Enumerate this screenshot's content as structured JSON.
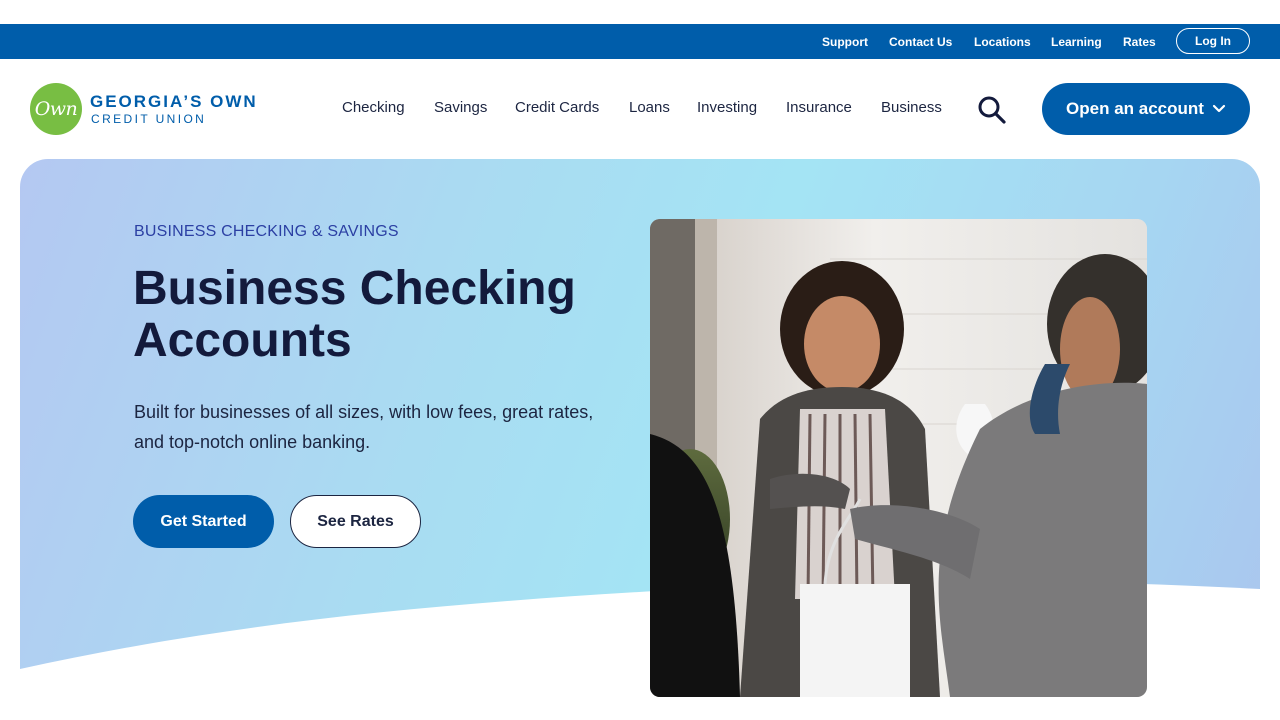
{
  "utility_nav": {
    "links": [
      "Support",
      "Contact Us",
      "Locations",
      "Learning",
      "Rates"
    ],
    "login_label": "Log In"
  },
  "header": {
    "logo": {
      "mark": "Own",
      "line1": "GEORGIA’S OWN",
      "line2": "CREDIT UNION"
    },
    "nav": [
      "Checking",
      "Savings",
      "Credit Cards",
      "Loans",
      "Investing",
      "Insurance",
      "Business"
    ],
    "search_icon": "search-icon",
    "open_account_label": "Open an account"
  },
  "hero": {
    "eyebrow": "BUSINESS CHECKING & SAVINGS",
    "title": "Business Checking Accounts",
    "description": "Built for businesses of all sizes, with low fees, great rates, and top-notch online banking.",
    "primary_button": "Get Started",
    "secondary_button": "See Rates"
  },
  "colors": {
    "brand_blue": "#005daa",
    "brand_green": "#78be43",
    "navy_text": "#131a3c",
    "eyebrow_blue": "#2b3fa3"
  }
}
